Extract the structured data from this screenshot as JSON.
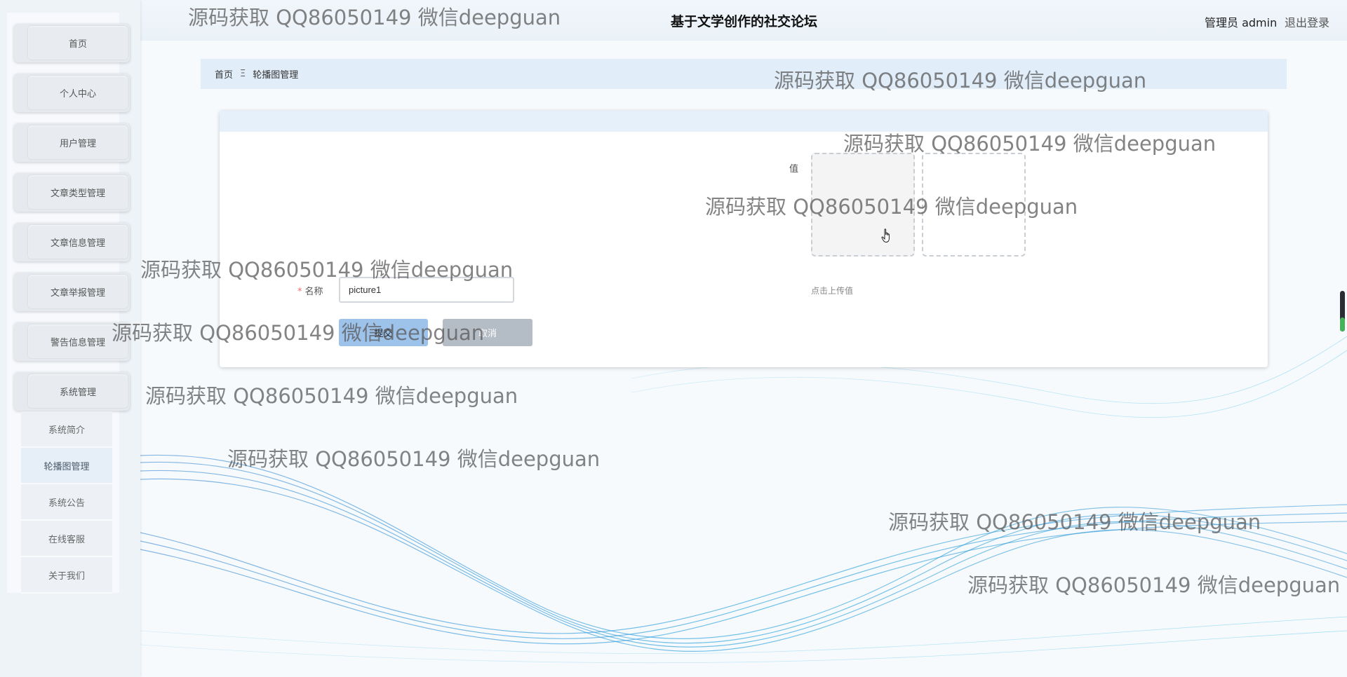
{
  "header": {
    "site_title": "基于文学创作的社交论坛",
    "user_label": "管理员 admin",
    "logout_label": "退出登录"
  },
  "sidebar": {
    "items": [
      {
        "label": "首页"
      },
      {
        "label": "个人中心"
      },
      {
        "label": "用户管理"
      },
      {
        "label": "文章类型管理"
      },
      {
        "label": "文章信息管理"
      },
      {
        "label": "文章举报管理"
      },
      {
        "label": "警告信息管理"
      },
      {
        "label": "系统管理"
      }
    ],
    "submenu": [
      {
        "label": "系统简介"
      },
      {
        "label": "轮播图管理",
        "active": true
      },
      {
        "label": "系统公告"
      },
      {
        "label": "在线客服"
      },
      {
        "label": "关于我们"
      }
    ]
  },
  "breadcrumb": {
    "home": "首页",
    "separator_icon": "menu-fold-icon",
    "separator": "Ξ",
    "current": "轮播图管理"
  },
  "form": {
    "value_label": "值",
    "upload_tip": "点击上传值",
    "name_required": "*",
    "name_label": "名称",
    "name_value": "picture1",
    "submit_label": "提交",
    "cancel_label": "取消"
  },
  "watermark": "源码获取 QQ86050149 微信deepguan",
  "colors": {
    "accent": "#9ec3eb",
    "breadcrumb_bg": "#e1edf9",
    "required": "#f56c6c",
    "wave": "#3aa6dc"
  }
}
